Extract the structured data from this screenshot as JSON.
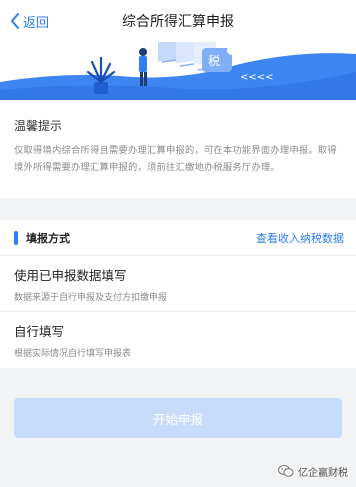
{
  "nav": {
    "back_label": "返回",
    "title": "综合所得汇算申报"
  },
  "banner": {
    "badge_text": "税",
    "chevrons": "<<<<"
  },
  "notice": {
    "title": "温馨提示",
    "body": "仅取得境内综合所得且需要办理汇算申报的，可在本功能界面办理申报。取得境外所得需要办理汇算申报的，须前往汇缴地办税服务厅办理。"
  },
  "fill_mode": {
    "title": "填报方式",
    "link": "查看收入纳税数据",
    "options": [
      {
        "title": "使用已申报数据填写",
        "desc": "数据来源于自行申报及支付方扣缴申报"
      },
      {
        "title": "自行填写",
        "desc": "根据实际情况自行填写申报表"
      }
    ]
  },
  "action": {
    "start_label": "开始申报"
  },
  "watermark": {
    "text": "亿企赢财税"
  },
  "colors": {
    "accent": "#2e7cf6",
    "button_disabled": "#c7dcfb",
    "banner_blue": "#3d86f2"
  }
}
